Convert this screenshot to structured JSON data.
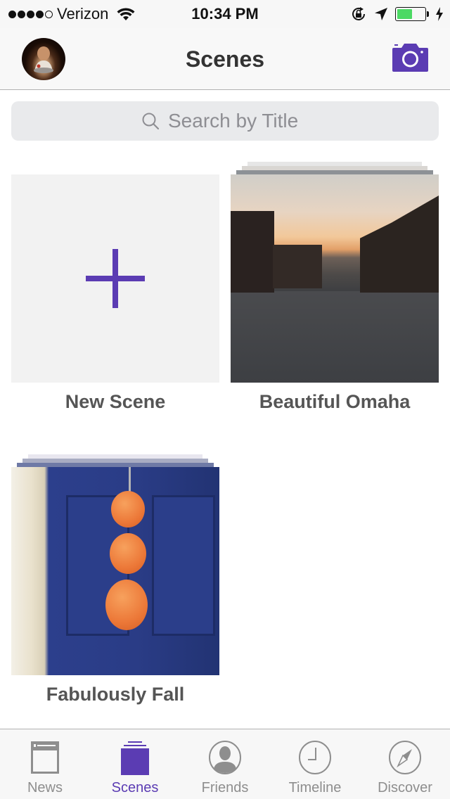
{
  "status_bar": {
    "carrier": "Verizon",
    "signal_bars_filled": 4,
    "signal_bars_total": 5,
    "time": "10:34 PM",
    "battery_level": 0.55,
    "icons": [
      "wifi-icon",
      "orientation-lock-icon",
      "location-arrow-icon",
      "battery-icon",
      "charging-bolt-icon"
    ]
  },
  "nav": {
    "title": "Scenes",
    "left_icon": "profile-avatar",
    "right_icon": "camera-icon"
  },
  "search": {
    "placeholder": "Search by Title",
    "value": ""
  },
  "scenes": [
    {
      "label": "New Scene",
      "type": "new"
    },
    {
      "label": "Beautiful Omaha",
      "type": "photo"
    },
    {
      "label": "Fabulously Fall",
      "type": "photo"
    }
  ],
  "tab_bar": {
    "active": "Scenes",
    "tabs": [
      {
        "label": "News",
        "icon": "news-icon"
      },
      {
        "label": "Scenes",
        "icon": "scenes-icon"
      },
      {
        "label": "Friends",
        "icon": "friends-icon"
      },
      {
        "label": "Timeline",
        "icon": "timeline-clock-icon"
      },
      {
        "label": "Discover",
        "icon": "compass-icon"
      }
    ]
  },
  "colors": {
    "accent": "#5b3cb3",
    "inactive": "#8e8e8e",
    "battery": "#4cd964"
  }
}
